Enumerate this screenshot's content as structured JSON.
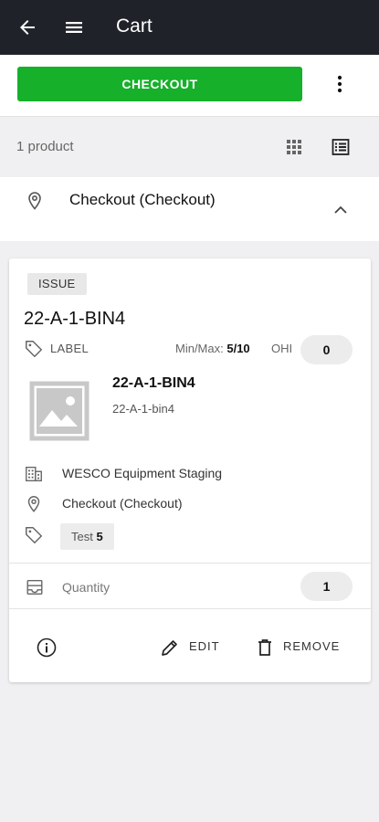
{
  "header": {
    "title": "Cart",
    "back_icon": "arrow-left-icon",
    "menu_icon": "hamburger-menu-icon"
  },
  "toolbar": {
    "checkout_label": "CHECKOUT",
    "checkout_color": "#16b02a",
    "more_icon": "kebab-menu-icon"
  },
  "summary": {
    "product_count": "1 product",
    "grid_view_icon": "grid-view-icon",
    "list_view_icon": "list-view-icon"
  },
  "location_group": {
    "name": "Checkout (Checkout)",
    "icon": "location-pin-icon",
    "toggle_icon": "chevron-up-icon"
  },
  "item": {
    "badge": "ISSUE",
    "bin": "22-A-1-BIN4",
    "label_text": "LABEL",
    "minmax_label": "Min/Max:",
    "minmax_value": "5/10",
    "ohi_label": "OHI",
    "ohi_value": "0",
    "product_name": "22-A-1-BIN4",
    "product_sub": "22-A-1-bin4",
    "facility": "WESCO Equipment Staging",
    "location": "Checkout (Checkout)",
    "tag_name": "Test",
    "tag_count": "5",
    "quantity_label": "Quantity",
    "quantity_value": "1",
    "edit_label": "EDIT",
    "remove_label": "REMOVE"
  }
}
